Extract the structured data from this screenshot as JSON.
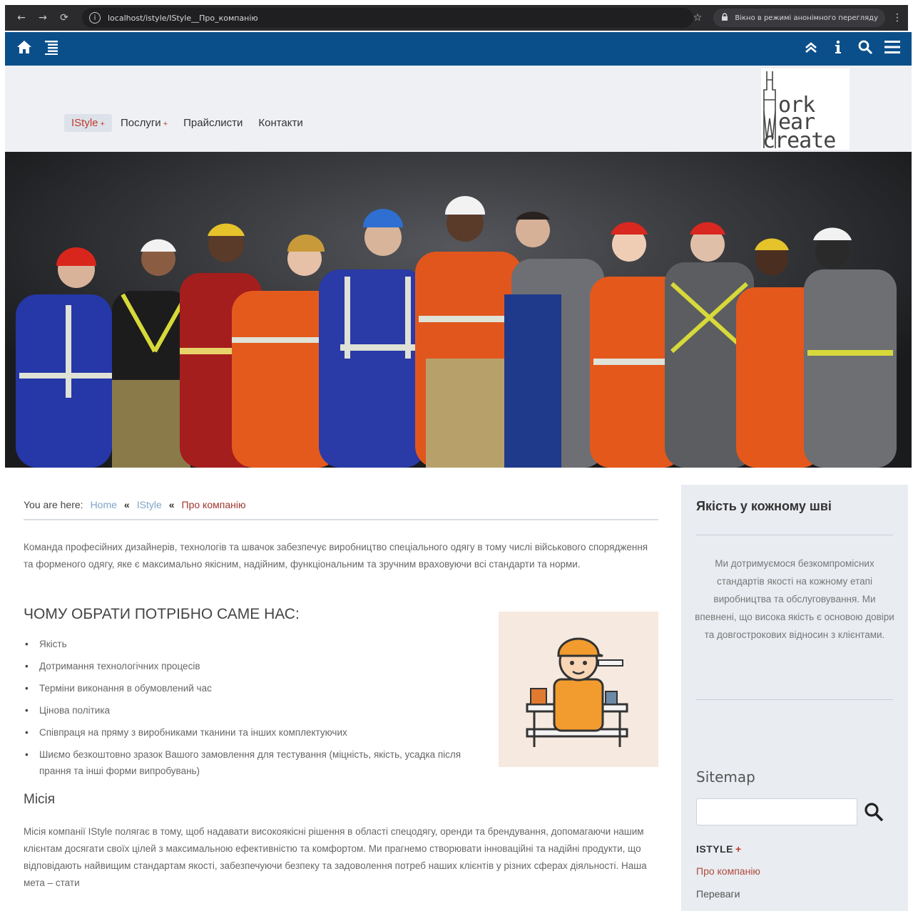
{
  "browser": {
    "url": "localhost/istyle/IStyle__Про_компанію",
    "incognito_label": "Вікно в режимі анонімного перегляду",
    "back_icon": "←",
    "forward_icon": "→",
    "reload_icon": "⟳",
    "star_icon": "☆",
    "menu_icon": "⋮"
  },
  "topbar": {
    "home_icon": "home-icon",
    "list_icon": "list-icon",
    "up_icon": "double-chevron-up-icon",
    "info_icon": "info-icon",
    "search_icon": "search-icon",
    "menu_icon": "hamburger-icon"
  },
  "nav": {
    "items": [
      {
        "label": "IStyle",
        "caret": "+",
        "active": true
      },
      {
        "label": "Послуги",
        "caret": "+",
        "active": false
      },
      {
        "label": "Прайслисти",
        "caret": "",
        "active": false
      },
      {
        "label": "Контакти",
        "caret": "",
        "active": false
      }
    ]
  },
  "logo": {
    "line1": "ork",
    "line2": "ear",
    "line3": "create"
  },
  "breadcrumb": {
    "prefix": "You are here:",
    "home": "Home",
    "sep": "«",
    "parent": "IStyle",
    "current": "Про компанію"
  },
  "article": {
    "intro": "Команда професійних дизайнерів, технологів та швачок забезпечує виробництво спеціального одягу в тому числі військового спорядження та форменого одягу, яке є максимально якісним, надійним, функціональним та зручним враховуючи всі стандарти та норми.",
    "why_title": "ЧОМУ ОБРАТИ ПОТРІБНО САМЕ НАС:",
    "why_items": [
      "Якість",
      "Дотримання технологічних процесів",
      "Терміни виконання в обумовлений час",
      "Цінова політика",
      "Співпраця на пряму з виробниками тканини та інших комплектуючих",
      "Шиємо безкоштовно зразок Вашого замовлення для тестування (міцність, якість, усадка після прання та інші форми випробувань)"
    ],
    "mission_title": "Місія",
    "mission_text": "Місія компанії IStyle полягає в тому, щоб надавати високоякісні рішення в області спецодягу, оренди та брендування, допомагаючи нашим клієнтам досягати своїх цілей з максимальною ефективністю та комфортом. Ми прагнемо створювати інноваційні та надійні продукти, що відповідають найвищим стандартам якості, забезпечуючи безпеку та задоволення потреб наших клієнтів у різних сферах діяльності. Наша мета – стати"
  },
  "sidebar": {
    "title": "Якість у кожному шві",
    "text": "Ми дотримуємося безкомпромісних стандартів якості на кожному етапі виробництва та обслуговування. Ми впевнені, що висока якість є основою довіри та довгострокових відносин з клієнтами.",
    "sitemap": "Sitemap",
    "search_value": "",
    "menu_head": "ISTYLE",
    "menu_caret": "+",
    "menu_items": [
      "Про компанію",
      "Переваги"
    ]
  },
  "colors": {
    "topbar": "#0b4f8a",
    "accent": "#c0392b",
    "header_bg": "#eef0f4",
    "sidebar_bg": "#e9ecf1"
  }
}
